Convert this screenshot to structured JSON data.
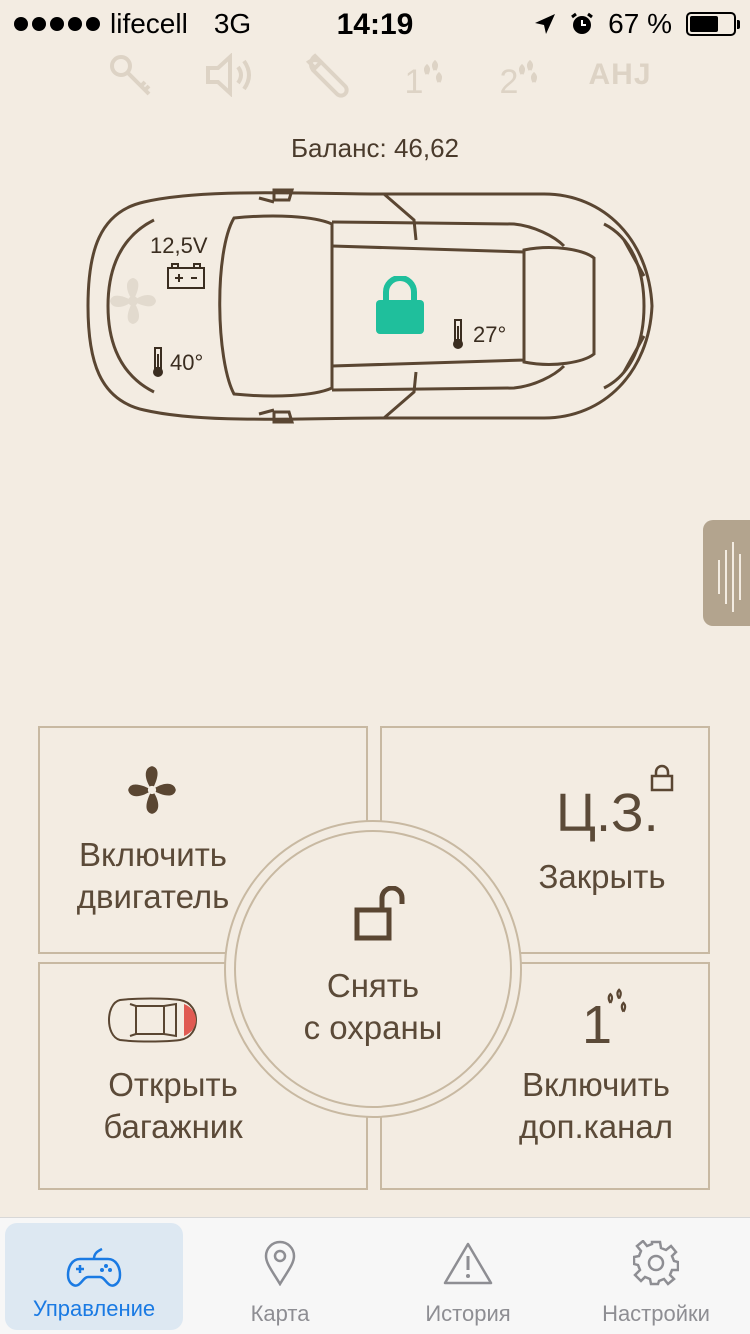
{
  "status_bar": {
    "carrier": "lifecell",
    "network": "3G",
    "time": "14:19",
    "battery_percent": "67 %",
    "battery_level": 0.67
  },
  "indicators": {
    "channel1": "1",
    "channel2": "2",
    "ahj": "AHJ"
  },
  "balance": "Баланс: 46,62",
  "car": {
    "voltage": "12,5V",
    "engine_temp": "40°",
    "cabin_temp": "27°",
    "lock_color": "#1fbf9c"
  },
  "controls": {
    "engine": {
      "line1": "Включить",
      "line2": "двигатель"
    },
    "central_lock": {
      "title": "Ц.З.",
      "label": "Закрыть"
    },
    "trunk": {
      "line1": "Открыть",
      "line2": "багажник"
    },
    "aux_channel": {
      "number": "1",
      "line1": "Включить",
      "line2": "доп.канал"
    },
    "disarm": {
      "line1": "Снять",
      "line2": "с охраны"
    }
  },
  "tabs": [
    {
      "label": "Управление",
      "icon": "gamepad-icon",
      "active": true
    },
    {
      "label": "Карта",
      "icon": "map-pin-icon",
      "active": false
    },
    {
      "label": "История",
      "icon": "warning-icon",
      "active": false
    },
    {
      "label": "Настройки",
      "icon": "gear-icon",
      "active": false
    }
  ],
  "colors": {
    "background": "#f3ece2",
    "accent": "#1fbf9c",
    "active_tab": "#1a7ae3",
    "tile_border": "#c8b9a2"
  }
}
